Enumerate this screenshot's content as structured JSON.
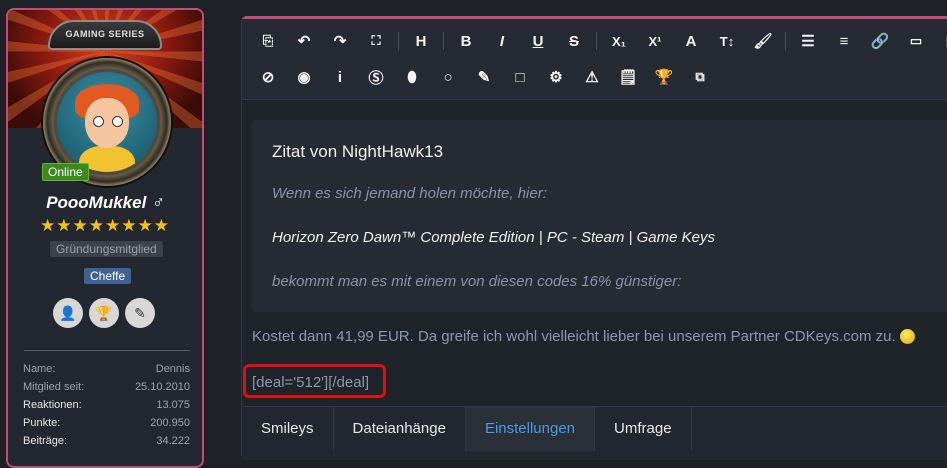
{
  "profile": {
    "banner_title": "GAMING SERIES",
    "status_badge": "Online",
    "username": "PoooMukkel ♂",
    "stars": "★★★★★★★★",
    "rank_primary": "Gründungsmitglied",
    "rank_secondary": "Cheffe",
    "stats": [
      {
        "key": "Name:",
        "value": "Dennis"
      },
      {
        "key": "Mitglied seit:",
        "value": "25.10.2010"
      },
      {
        "key": "Reaktionen:",
        "value": "13.075"
      },
      {
        "key": "Punkte:",
        "value": "200.950"
      },
      {
        "key": "Beiträge:",
        "value": "34.222"
      }
    ]
  },
  "toolbar": {
    "row1": [
      "source",
      "undo",
      "redo",
      "fullscreen",
      "heading",
      "bold",
      "italic",
      "underline",
      "strikethrough",
      "subscript",
      "superscript",
      "font",
      "text-size",
      "paint",
      "list",
      "align",
      "link",
      "image",
      "more"
    ],
    "row2": [
      "block",
      "user",
      "info",
      "s-badge",
      "o-badge",
      "circle",
      "edit",
      "square",
      "gear",
      "warning",
      "note",
      "trophy",
      "camera"
    ]
  },
  "quote": {
    "title": "Zitat von NightHawk13",
    "line1": "Wenn es sich jemand holen möchte, hier:",
    "line2": "Horizon Zero Dawn™ Complete Edition | PC - Steam | Game Keys",
    "line3": "bekommt man es mit einem von diesen codes 16% günstiger:"
  },
  "body_text": "Kostet dann 41,99 EUR. Da greife ich wohl vielleicht lieber bei unserem Partner CDKeys.com zu.",
  "deal_code": "[deal='512'][/deal]",
  "tabs": [
    "Smileys",
    "Dateianhänge",
    "Einstellungen",
    "Umfrage"
  ],
  "colors": {
    "accent_border": "#c14b7a",
    "highlight_red": "#e01010",
    "active_tab": "#4d9be0"
  }
}
